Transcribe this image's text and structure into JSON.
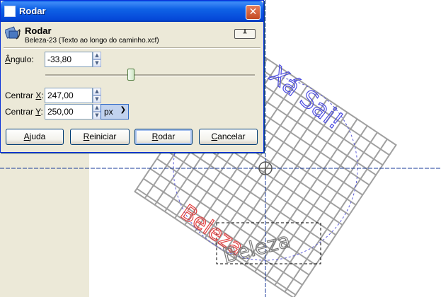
{
  "window": {
    "title": "Rodar"
  },
  "header": {
    "title": "Rodar",
    "subtitle": "Beleza-23 (Texto ao longo do caminho.xcf)"
  },
  "fields": {
    "angle": {
      "label_prefix": "",
      "label_mnemonic": "Â",
      "label_rest": "ngulo:",
      "value": "-33,80",
      "slider_fraction": 0.41
    },
    "center_x": {
      "label_prefix": "Centrar ",
      "label_mnemonic": "X",
      "label_rest": ":",
      "value": "247,00"
    },
    "center_y": {
      "label_prefix": "Centrar ",
      "label_mnemonic": "Y",
      "label_rest": ":",
      "value": "250,00"
    },
    "unit": {
      "value": "px"
    }
  },
  "buttons": {
    "help": {
      "mnemonic": "A",
      "rest": "juda"
    },
    "reset": {
      "mnemonic": "R",
      "rest": "einiciar"
    },
    "rotate": {
      "mnemonic": "R",
      "rest": "odar"
    },
    "cancel": {
      "mnemonic": "C",
      "rest": "ancelar"
    }
  },
  "canvas": {
    "text_blue": "Xá Sai!",
    "text_red": "Beleza",
    "text_gray": "Beleza",
    "colors": {
      "grid": "#9a9a9a",
      "blue_text": "#4a4ae0",
      "red_text": "#e04040",
      "guide": "#0033aa"
    }
  },
  "icons": {
    "title": "gimp-window-icon",
    "tool": "rotate-tool-icon",
    "pin": "pin-icon",
    "close": "close-icon",
    "spin_up": "spin-up-icon",
    "spin_down": "spin-down-icon",
    "unit_arrow": "chevron-down-icon"
  }
}
